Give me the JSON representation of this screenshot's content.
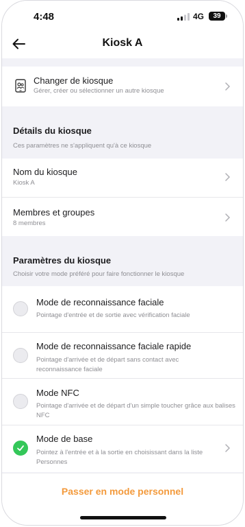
{
  "status_bar": {
    "time": "4:48",
    "network": "4G",
    "battery": "39"
  },
  "header": {
    "title": "Kiosk A",
    "back_icon": "arrow-left-icon"
  },
  "change_kiosk": {
    "icon": "tablet-users-icon",
    "title": "Changer de kiosque",
    "subtitle": "Gérer, créer ou sélectionner un autre kiosque"
  },
  "kiosk_details": {
    "heading": "Détails du kiosque",
    "description": "Ces paramètres ne s'appliquent qu'à ce kiosque",
    "items": [
      {
        "title": "Nom du kiosque",
        "value": "Kiosk A"
      },
      {
        "title": "Membres et groupes",
        "value": "8 membres"
      }
    ]
  },
  "kiosk_settings": {
    "heading": "Paramètres du kiosque",
    "description": "Choisir votre mode préféré pour faire fonctionner le kiosque",
    "modes": [
      {
        "title": "Mode de reconnaissance faciale",
        "description": "Pointage d'entrée et de sortie avec vérification faciale",
        "selected": false
      },
      {
        "title": "Mode de reconnaissance faciale rapide",
        "description": "Pointage d'arrivée et de départ sans contact avec reconnaissance faciale",
        "selected": false
      },
      {
        "title": "Mode NFC",
        "description": "Pointage d'arrivée et de départ d'un simple toucher grâce aux balises NFC",
        "selected": false
      },
      {
        "title": "Mode de base",
        "description": "Pointez à l'entrée et à la sortie en choisissant dans la liste Personnes",
        "selected": true
      }
    ]
  },
  "footer": {
    "action_label": "Passer en mode personnel"
  },
  "colors": {
    "accent": "#f39a3c",
    "selected": "#34c759",
    "background": "#f2f2f7"
  }
}
